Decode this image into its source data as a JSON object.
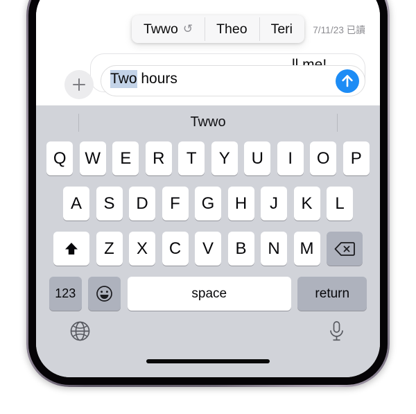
{
  "conversation": {
    "read_receipt": "7/11/23 已讀",
    "incoming_bubble_text": "ll me!",
    "send_icon": "send-arrow-up-icon"
  },
  "compose": {
    "attach_icon": "plus-icon",
    "selected_text": "Two",
    "rest_text": " hours",
    "send_label": "send-button"
  },
  "autocorrect": {
    "items": [
      {
        "label": "Twwo",
        "revert_icon": "↺",
        "has_revert": true
      },
      {
        "label": "Theo",
        "has_revert": false
      },
      {
        "label": "Teri",
        "has_revert": false
      }
    ]
  },
  "keyboard": {
    "predictive_word": "Twwo",
    "row1": [
      "Q",
      "W",
      "E",
      "R",
      "T",
      "Y",
      "U",
      "I",
      "O",
      "P"
    ],
    "row2": [
      "A",
      "S",
      "D",
      "F",
      "G",
      "H",
      "J",
      "K",
      "L"
    ],
    "row3_letters": [
      "Z",
      "X",
      "C",
      "V",
      "B",
      "N",
      "M"
    ],
    "shift_icon": "shift-arrow-up-icon",
    "backspace_icon": "backspace-delete-icon",
    "numeric_label": "123",
    "emoji_icon": "emoji-smiley-icon",
    "space_label": "space",
    "return_label": "return",
    "globe_icon": "globe-language-icon",
    "mic_icon": "microphone-dictation-icon"
  },
  "colors": {
    "send_blue": "#1d8cf5",
    "keyboard_background": "#d1d3d9",
    "key_white": "#ffffff",
    "key_dark": "#aeb2bd",
    "selection_highlight": "#c3d3e8"
  }
}
